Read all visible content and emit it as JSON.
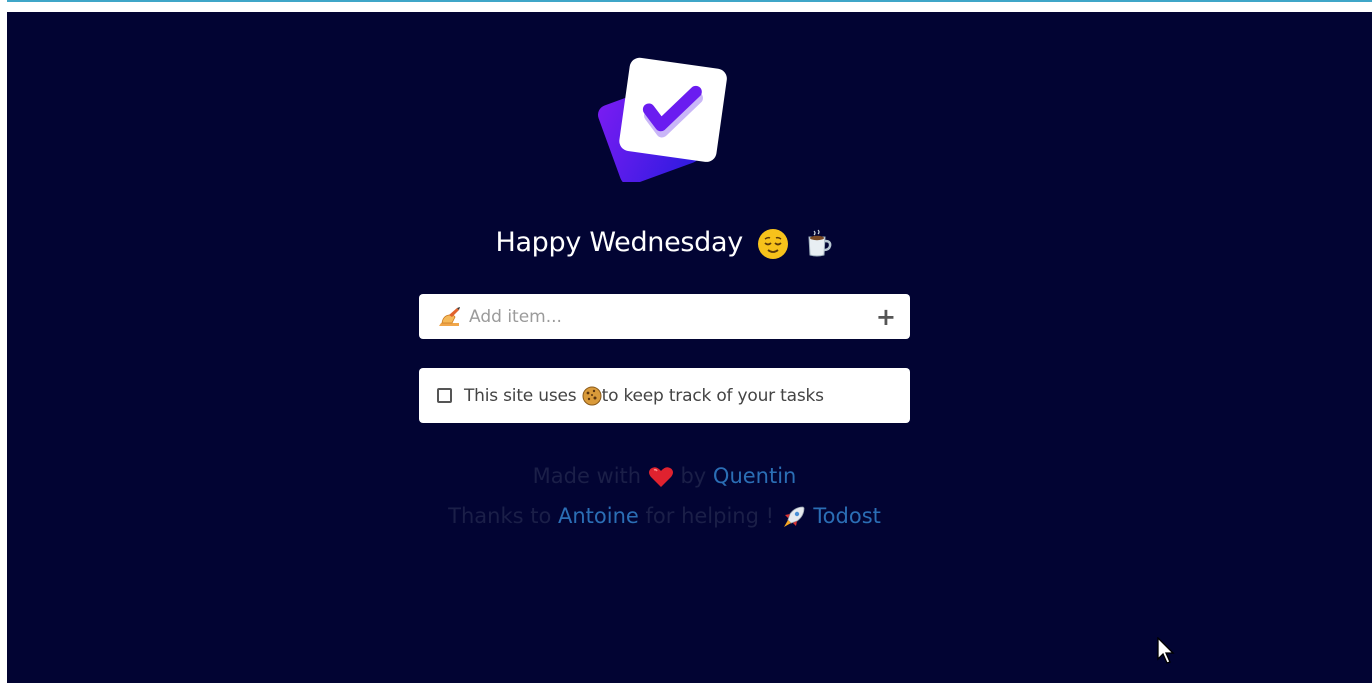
{
  "header": {
    "greeting": "Happy Wednesday",
    "greeting_emojis": [
      "relieved-face-icon",
      "hot-beverage-icon"
    ]
  },
  "add_item": {
    "placeholder": "Add item...",
    "value": "",
    "icon": "writing-hand-icon",
    "add_button_label": "+"
  },
  "task": {
    "prefix": "This site uses",
    "icon": "cookie-icon",
    "suffix": "to keep track of your tasks",
    "checked": false
  },
  "footer": {
    "made_with": "Made with",
    "by": "by",
    "author": "Quentin",
    "thanks_to": "Thanks to",
    "helper": "Antoine",
    "for_helping": "for helping !",
    "project": "Todost"
  },
  "colors": {
    "background": "#020433",
    "link": "#2b6eb5",
    "muted_text": "#1b1f48",
    "logo_purple": "#6a1cf0",
    "logo_blue": "#3d1be0"
  }
}
